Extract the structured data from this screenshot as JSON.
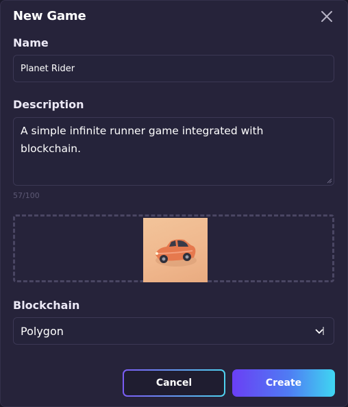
{
  "dialog": {
    "title": "New Game"
  },
  "form": {
    "name_label": "Name",
    "name_value": "Planet Rider",
    "description_label": "Description",
    "description_value": "A simple infinite runner game integrated with blockchain.",
    "char_counter": "57/100",
    "blockchain_label": "Blockchain",
    "blockchain_selected": "Polygon"
  },
  "image": {
    "icon": "car-thumbnail"
  },
  "actions": {
    "cancel_label": "Cancel",
    "create_label": "Create"
  },
  "colors": {
    "background": "#26233a",
    "accent_start": "#6a3ff5",
    "accent_end": "#3fd6f2"
  }
}
